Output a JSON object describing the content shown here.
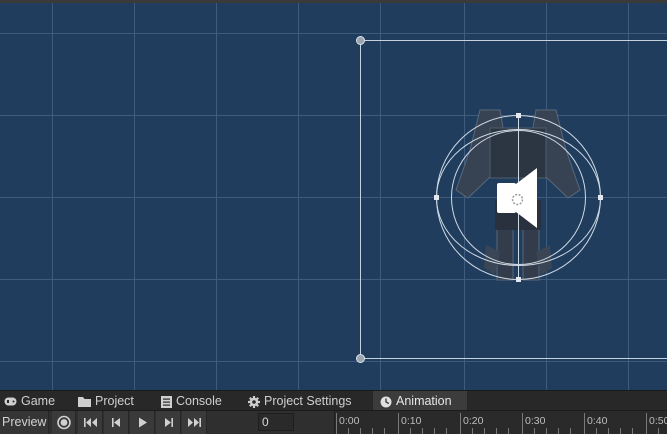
{
  "bottom_tabs": [
    {
      "label": "Game",
      "icon": "gamepad-icon",
      "active": false
    },
    {
      "label": "Project",
      "icon": "folder-icon",
      "active": false
    },
    {
      "label": "Console",
      "icon": "console-icon",
      "active": false
    },
    {
      "label": "Project Settings",
      "icon": "gear-icon",
      "active": false
    },
    {
      "label": "Animation",
      "icon": "clock-icon",
      "active": true
    }
  ],
  "animation_toolbar": {
    "preview_label": "Preview",
    "frame_value": "0",
    "timeline_ticks": [
      "0:00",
      "0:10",
      "0:20",
      "0:30",
      "0:40",
      "0:50"
    ]
  },
  "scene": {
    "background_color": "#213d5e",
    "grid_color": "#3f5e80",
    "selected_object": "audio-source-gizmo"
  }
}
